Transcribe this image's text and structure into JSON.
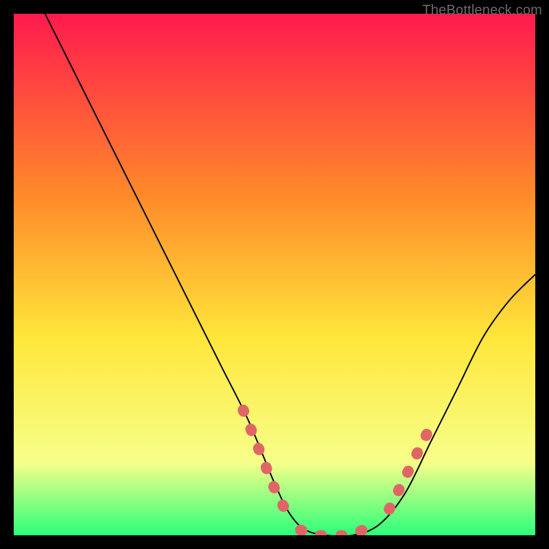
{
  "watermark": "TheBottleneck.com",
  "chart_data": {
    "type": "line",
    "title": "",
    "xlabel": "",
    "ylabel": "",
    "xlim": [
      0,
      100
    ],
    "ylim": [
      0,
      100
    ],
    "grid": false,
    "legend": false,
    "background_gradient": {
      "top": "#ff1a4e",
      "mid1": "#ff8a2a",
      "mid2": "#ffe63a",
      "low": "#f7ff8a",
      "bottom": "#2cff7a"
    },
    "series": [
      {
        "name": "bottleneck-curve",
        "color": "#000000",
        "x": [
          6,
          10,
          15,
          20,
          25,
          30,
          35,
          40,
          45,
          50,
          53,
          56,
          60,
          65,
          70,
          75,
          80,
          85,
          90,
          95,
          100
        ],
        "y": [
          100,
          92,
          82,
          72,
          62,
          52,
          42,
          32,
          22,
          10,
          4,
          1,
          0,
          0,
          2,
          8,
          18,
          28,
          38,
          45,
          50
        ]
      }
    ],
    "marker_segments": [
      {
        "name": "left-markers",
        "color": "#e06666",
        "x": [
          44,
          46,
          48,
          50,
          52
        ],
        "y": [
          24,
          19,
          14,
          9,
          5
        ]
      },
      {
        "name": "bottom-markers",
        "color": "#e06666",
        "x": [
          55,
          58,
          61,
          64,
          67
        ],
        "y": [
          1,
          0,
          0,
          0,
          1
        ]
      },
      {
        "name": "right-markers",
        "color": "#e06666",
        "x": [
          72,
          74,
          76,
          78,
          80
        ],
        "y": [
          5,
          9,
          13,
          17,
          21
        ]
      }
    ]
  }
}
